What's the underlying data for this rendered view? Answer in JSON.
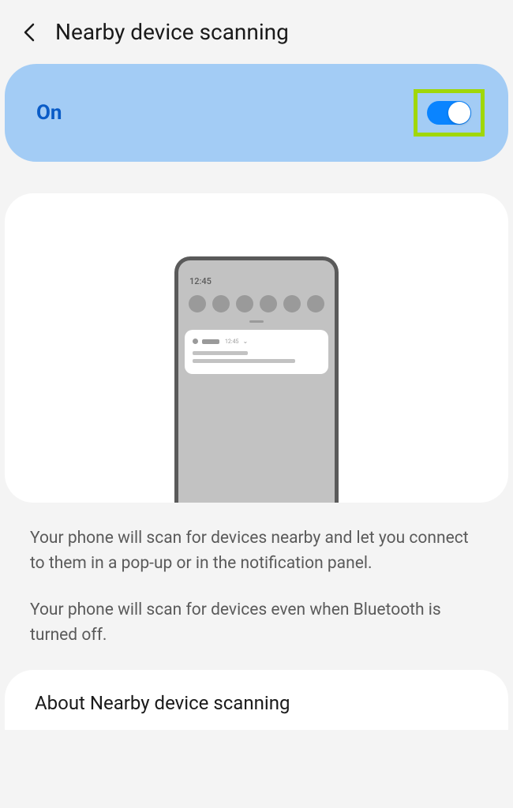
{
  "header": {
    "title": "Nearby device scanning"
  },
  "toggle": {
    "label": "On",
    "state": true
  },
  "illustration": {
    "time": "12:45",
    "notif_time": "12:45"
  },
  "description": {
    "para1": "Your phone will scan for devices nearby and let you connect to them in a pop-up or in the notification panel.",
    "para2": "Your phone will scan for devices even when Bluetooth is turned off."
  },
  "about": {
    "label": "About Nearby device scanning"
  }
}
